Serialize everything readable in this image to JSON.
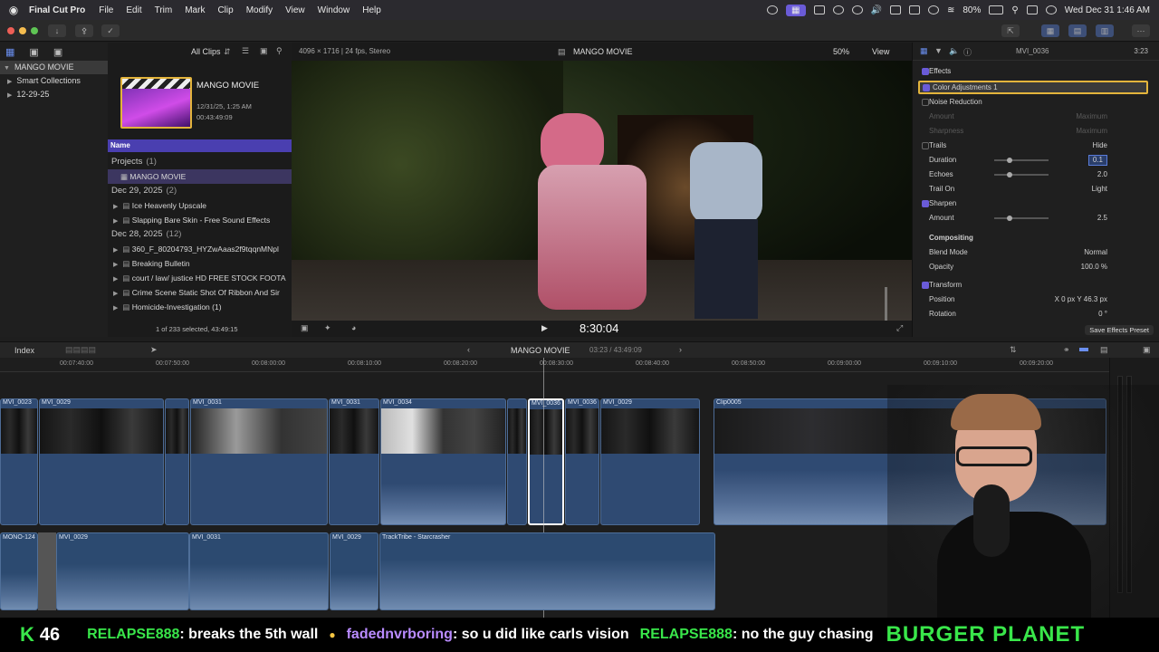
{
  "menubar": {
    "app_name": "Final Cut Pro",
    "items": [
      "File",
      "Edit",
      "Trim",
      "Mark",
      "Clip",
      "Modify",
      "View",
      "Window",
      "Help"
    ],
    "battery": "80%",
    "datetime": "Wed Dec 31  1:46 AM"
  },
  "browser": {
    "filter": "All Clips",
    "library": "MANGO MOVIE",
    "library_items": [
      "Smart Collections",
      "12-29-25"
    ],
    "project_thumb": {
      "name": "MANGO MOVIE",
      "date": "12/31/25, 1:25 AM",
      "duration": "00:43:49:09"
    },
    "column_header": "Name",
    "rows": [
      {
        "type": "section",
        "label": "Projects",
        "count": "(1)"
      },
      {
        "type": "project",
        "label": "MANGO MOVIE"
      },
      {
        "type": "section",
        "label": "Dec 29, 2025",
        "count": "(2)"
      },
      {
        "type": "item",
        "label": "Ice Heavenly Upscale"
      },
      {
        "type": "item",
        "label": "Slapping Bare Skin - Free Sound Effects"
      },
      {
        "type": "section",
        "label": "Dec 28, 2025",
        "count": "(12)"
      },
      {
        "type": "item",
        "label": "360_F_80204793_HYZwAaas2f9tqqnMNpl"
      },
      {
        "type": "item",
        "label": "Breaking Bulletin"
      },
      {
        "type": "item",
        "label": "court / law/ justice HD FREE STOCK FOOTA"
      },
      {
        "type": "item",
        "label": "Crime Scene Static Shot Of Ribbon And Sir"
      },
      {
        "type": "item",
        "label": "Homicide-Investigation (1)"
      }
    ],
    "status": "1 of 233 selected, 43:49:15"
  },
  "viewer": {
    "format": "4096 × 1716 | 24 fps, Stereo",
    "title": "MANGO MOVIE",
    "zoom": "50%",
    "view_menu": "View",
    "timecode": "8:30:04"
  },
  "inspector": {
    "clip_name": "MVI_0036",
    "duration": "3:23",
    "effects_header": "Effects",
    "rows": [
      {
        "label": "Color Adjustments 1",
        "kind": "highlight"
      },
      {
        "label": "Noise Reduction",
        "kind": "check-off"
      },
      {
        "label": "Amount",
        "value": "Maximum",
        "kind": "dim"
      },
      {
        "label": "Sharpness",
        "value": "Maximum",
        "kind": "dim"
      },
      {
        "label": "Trails",
        "value": "Hide",
        "kind": "check-off"
      },
      {
        "label": "Duration",
        "value": "0.1",
        "kind": "param"
      },
      {
        "label": "Echoes",
        "value": "2.0",
        "kind": "param"
      },
      {
        "label": "Trail On",
        "value": "Light",
        "kind": "param"
      },
      {
        "label": "Sharpen",
        "kind": "check-on"
      },
      {
        "label": "Amount",
        "value": "2.5",
        "kind": "param"
      },
      {
        "label": "Compositing",
        "kind": "header"
      },
      {
        "label": "Blend Mode",
        "value": "Normal",
        "kind": "param"
      },
      {
        "label": "Opacity",
        "value": "100.0 %",
        "kind": "param"
      },
      {
        "label": "Transform",
        "kind": "check-on"
      },
      {
        "label": "Position",
        "value": "X   0 px   Y   46.3 px",
        "kind": "param"
      },
      {
        "label": "Rotation",
        "value": "0 °",
        "kind": "param"
      }
    ],
    "save_button": "Save Effects Preset"
  },
  "timeline": {
    "index_label": "Index",
    "project": "MANGO MOVIE",
    "position": "03:23 / 43:49:09",
    "ruler": [
      "00:07:40:00",
      "00:07:50:00",
      "00:08:00:00",
      "00:08:10:00",
      "00:08:20:00",
      "00:08:30:00",
      "00:08:40:00",
      "00:08:50:00",
      "00:09:00:00",
      "00:09:10:00",
      "00:09:20:00"
    ],
    "video_clips": [
      "MVI_0023",
      "MVI_0029",
      "MVI_0031",
      "MVI_0031",
      "MVI_0034",
      "MVI_0036",
      "MVI_0036",
      "MVI_0029",
      "Clip0005"
    ],
    "audio_clips": [
      "MONO-124",
      "MVI_0029",
      "MVI_0031",
      "MVI_0029",
      "TrackTribe - Starcrasher"
    ]
  },
  "ticker": {
    "count": "46",
    "messages": [
      {
        "user": "RELAPSE888",
        "text": ": breaks the 5th wall"
      },
      {
        "user": "fadednvrboring",
        "text": ": so u did like carls vision"
      },
      {
        "user": "RELAPSE888",
        "text": ": no the guy chasing"
      }
    ],
    "brand": "BURGER PLANET"
  }
}
